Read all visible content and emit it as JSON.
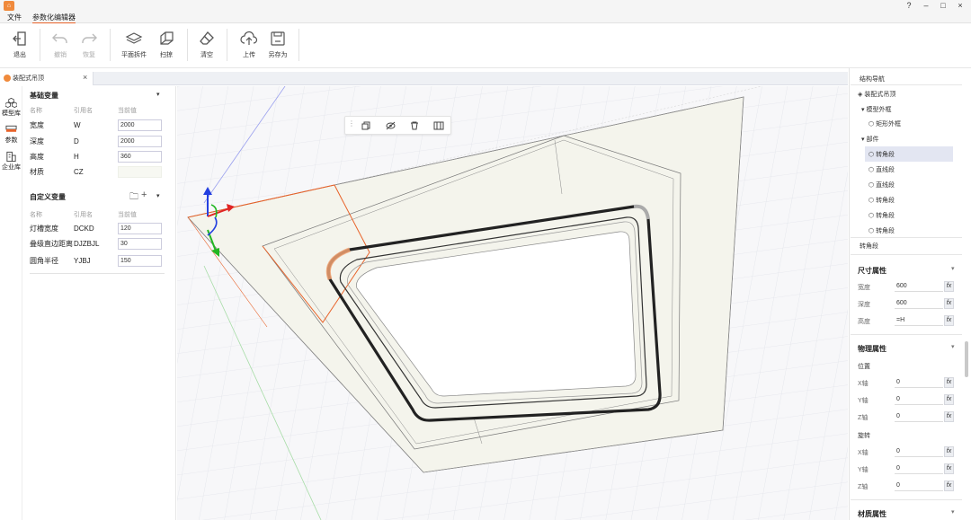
{
  "app": {
    "icon": "home-icon"
  },
  "window_controls": {
    "help": "?",
    "minimize": "–",
    "maximize": "□",
    "close": "×"
  },
  "menu": {
    "file": "文件",
    "active": "参数化编辑器"
  },
  "toolbar": {
    "exit": "退出",
    "undo": "撤销",
    "redo": "恢复",
    "plane_profile": "平面拆件",
    "sweep": "扫掠",
    "clear": "清空",
    "upload": "上传",
    "save_as": "另存为"
  },
  "tab": {
    "title": "装配式吊顶",
    "close": "×"
  },
  "leftnav": {
    "model_lib": "模型库",
    "params": "参数",
    "enterprise": "企业库"
  },
  "basic_vars": {
    "title": "基础变量",
    "headers": {
      "name": "名称",
      "ref": "引用名",
      "value": "当前值"
    },
    "rows": [
      {
        "name": "宽度",
        "ref": "W",
        "value": "2000"
      },
      {
        "name": "深度",
        "ref": "D",
        "value": "2000"
      },
      {
        "name": "高度",
        "ref": "H",
        "value": "360"
      },
      {
        "name": "材质",
        "ref": "CZ",
        "value": ""
      }
    ]
  },
  "custom_vars": {
    "title": "自定义变量",
    "add": "+",
    "headers": {
      "name": "名称",
      "ref": "引用名",
      "value": "当前值"
    },
    "rows": [
      {
        "name": "灯槽宽度",
        "ref": "DCKD",
        "value": "120"
      },
      {
        "name": "叠级直边距离",
        "ref": "DJZBJL",
        "value": "30"
      },
      {
        "name": "圆角半径",
        "ref": "YJBJ",
        "value": "150"
      }
    ]
  },
  "nav": {
    "title": "结构导航",
    "root": "装配式吊顶",
    "model_outline": "模型外框",
    "rect_outline": "矩形外框",
    "parts": "部件",
    "items": [
      "转角段",
      "直线段",
      "直线段",
      "转角段",
      "转角段",
      "转角段"
    ],
    "selected_name": "转角段"
  },
  "props": {
    "size_title": "尺寸属性",
    "width_label": "宽度",
    "width_value": "600",
    "depth_label": "深度",
    "depth_value": "600",
    "height_label": "高度",
    "height_value": "=H",
    "physics_title": "物理属性",
    "position_label": "位置",
    "pos_x_label": "X轴",
    "pos_x": "0",
    "pos_y_label": "Y轴",
    "pos_y": "0",
    "pos_z_label": "Z轴",
    "pos_z": "0",
    "rotation_label": "旋转",
    "rot_x_label": "X轴",
    "rot_x": "0",
    "rot_y_label": "Y轴",
    "rot_y": "0",
    "rot_z_label": "Z轴",
    "rot_z": "0",
    "material_title": "材质属性",
    "fx": "fx"
  },
  "colors": {
    "accent": "#e8632a",
    "selected": "#e3e6f2",
    "panel_fill": "#f5f5ee"
  }
}
